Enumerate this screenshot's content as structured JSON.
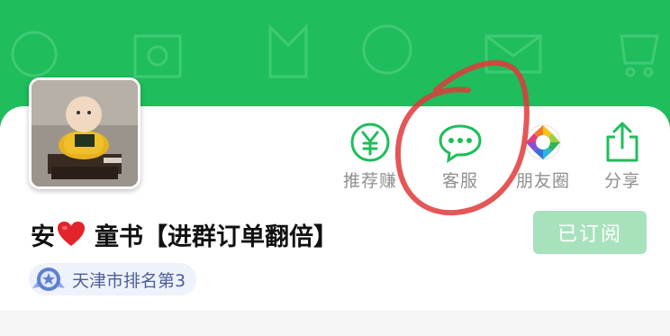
{
  "profile": {
    "name_prefix": "安",
    "name_suffix": "童书【进群订单翻倍】",
    "rank_text": "天津市排名第3"
  },
  "actions": [
    {
      "id": "recommend",
      "label": "推荐赚",
      "icon": "yen-circle-icon"
    },
    {
      "id": "service",
      "label": "客服",
      "icon": "chat-bubble-icon"
    },
    {
      "id": "moments",
      "label": "朋友圈",
      "icon": "aperture-icon"
    },
    {
      "id": "share",
      "label": "分享",
      "icon": "share-icon"
    }
  ],
  "subscribe_button": {
    "label": "已订阅"
  },
  "colors": {
    "brand_green": "#1fbd5c",
    "button_disabled": "#a8e2bd",
    "annotation_red": "#e03a3a"
  }
}
